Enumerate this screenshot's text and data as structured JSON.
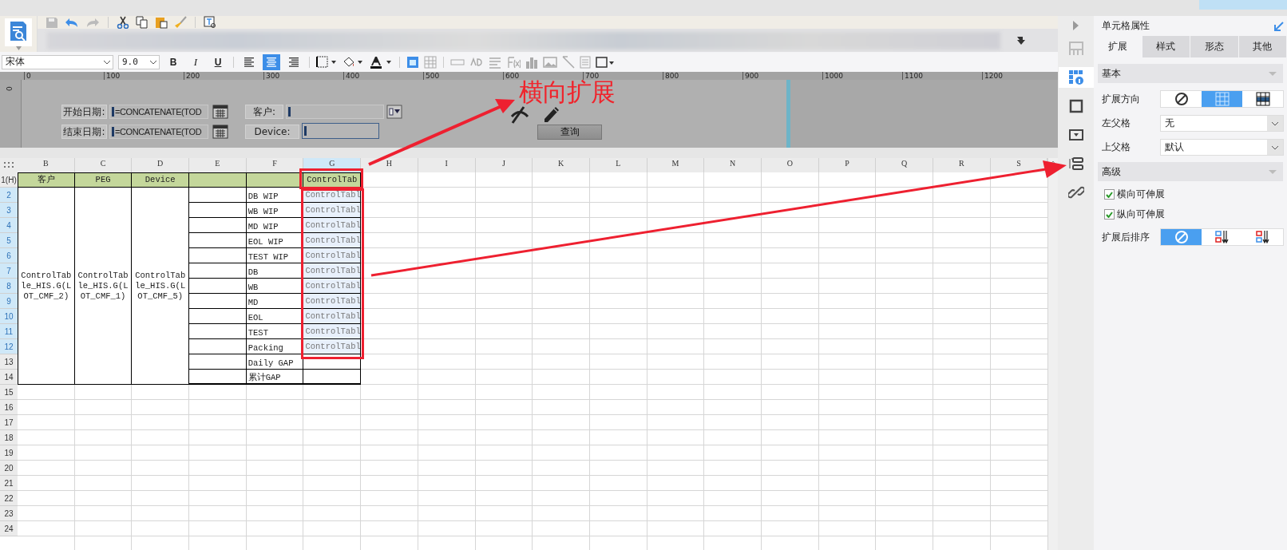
{
  "toolbar": {
    "font": "宋体",
    "font_size": "9.0",
    "bold": "B",
    "italic": "I",
    "underline": "U",
    "align": [
      {
        "selected": false
      },
      {
        "selected": true
      },
      {
        "selected": false
      }
    ]
  },
  "ruler": [
    "0",
    "100",
    "200",
    "300",
    "400",
    "500",
    "600",
    "700",
    "800",
    "900",
    "1000",
    "1100",
    "1200"
  ],
  "vertical_ruler": "0",
  "parameters": {
    "start_label": "开始日期:",
    "start_value": "=CONCATENATE(TOD",
    "end_label": "结束日期:",
    "end_value": "=CONCATENATE(TOD",
    "customer_label": "客户:",
    "device_label": "Device:",
    "query_button": "查询"
  },
  "annotation": "横向扩展",
  "sheet": {
    "columns": [
      {
        "label": "B",
        "selected": false
      },
      {
        "label": "C",
        "selected": false
      },
      {
        "label": "D",
        "selected": false
      },
      {
        "label": "E",
        "selected": false
      },
      {
        "label": "F",
        "selected": false
      },
      {
        "label": "G",
        "selected": true
      },
      {
        "label": "H",
        "selected": false
      },
      {
        "label": "I",
        "selected": false
      },
      {
        "label": "J",
        "selected": false
      },
      {
        "label": "K",
        "selected": false
      },
      {
        "label": "L",
        "selected": false
      },
      {
        "label": "M",
        "selected": false
      },
      {
        "label": "N",
        "selected": false
      },
      {
        "label": "O",
        "selected": false
      },
      {
        "label": "P",
        "selected": false
      },
      {
        "label": "Q",
        "selected": false
      },
      {
        "label": "R",
        "selected": false
      },
      {
        "label": "S",
        "selected": false
      }
    ],
    "row_numbers": [
      {
        "label": "1(H)",
        "selected": false
      },
      {
        "label": "2",
        "selected": true
      },
      {
        "label": "3",
        "selected": true
      },
      {
        "label": "4",
        "selected": true
      },
      {
        "label": "5",
        "selected": true
      },
      {
        "label": "6",
        "selected": true
      },
      {
        "label": "7",
        "selected": true
      },
      {
        "label": "8",
        "selected": true
      },
      {
        "label": "9",
        "selected": true
      },
      {
        "label": "10",
        "selected": true
      },
      {
        "label": "11",
        "selected": true
      },
      {
        "label": "12",
        "selected": true
      },
      {
        "label": "13",
        "selected": false
      },
      {
        "label": "14",
        "selected": false
      },
      {
        "label": "15",
        "selected": false
      },
      {
        "label": "16",
        "selected": false
      },
      {
        "label": "17",
        "selected": false
      },
      {
        "label": "18",
        "selected": false
      },
      {
        "label": "19",
        "selected": false
      },
      {
        "label": "20",
        "selected": false
      },
      {
        "label": "21",
        "selected": false
      },
      {
        "label": "22",
        "selected": false
      },
      {
        "label": "23",
        "selected": false
      },
      {
        "label": "24",
        "selected": false
      }
    ],
    "report_rows": [
      {
        "cells": [
          {
            "kind": "header",
            "text": "客户"
          },
          {
            "kind": "header",
            "text": "PEG"
          },
          {
            "kind": "header",
            "text": "Device"
          },
          {
            "kind": "header"
          },
          {
            "kind": "header"
          },
          {
            "kind": "header",
            "text": "ControlTab"
          }
        ]
      },
      {
        "cells": [
          {
            "kind": "merged",
            "text": "ControlTable_HIS.G(LOT_CMF_2)"
          },
          {
            "kind": "merged",
            "text": "ControlTable_HIS.G(LOT_CMF_1)"
          },
          {
            "kind": "merged",
            "text": "ControlTable_HIS.G(LOT_CMF_5)"
          },
          {
            "kind": "plain"
          },
          {
            "kind": "plain",
            "text": "DB WIP"
          },
          {
            "kind": "expand",
            "text": "ControlTabl"
          }
        ]
      },
      {
        "cells": [
          {
            "kind": "plain"
          },
          {
            "kind": "plain",
            "text": "WB WIP"
          },
          {
            "kind": "expand",
            "text": "ControlTabl"
          }
        ]
      },
      {
        "cells": [
          {
            "kind": "plain"
          },
          {
            "kind": "plain",
            "text": "MD WIP"
          },
          {
            "kind": "expand",
            "text": "ControlTabl"
          }
        ]
      },
      {
        "cells": [
          {
            "kind": "plain"
          },
          {
            "kind": "plain",
            "text": "EOL WIP"
          },
          {
            "kind": "expand",
            "text": "ControlTabl"
          }
        ]
      },
      {
        "cells": [
          {
            "kind": "plain"
          },
          {
            "kind": "plain",
            "text": "TEST WIP"
          },
          {
            "kind": "expand",
            "text": "ControlTabl"
          }
        ]
      },
      {
        "cells": [
          {
            "kind": "plain"
          },
          {
            "kind": "plain",
            "text": "DB"
          },
          {
            "kind": "expand",
            "text": "ControlTabl"
          }
        ]
      },
      {
        "cells": [
          {
            "kind": "plain"
          },
          {
            "kind": "plain",
            "text": "WB"
          },
          {
            "kind": "expand",
            "text": "ControlTabl"
          }
        ]
      },
      {
        "cells": [
          {
            "kind": "plain"
          },
          {
            "kind": "plain",
            "text": "MD"
          },
          {
            "kind": "expand",
            "text": "ControlTabl"
          }
        ]
      },
      {
        "cells": [
          {
            "kind": "plain"
          },
          {
            "kind": "plain",
            "text": "EOL"
          },
          {
            "kind": "expand",
            "text": "ControlTabl"
          }
        ]
      },
      {
        "cells": [
          {
            "kind": "plain"
          },
          {
            "kind": "plain",
            "text": "TEST"
          },
          {
            "kind": "expand",
            "text": "ControlTabl"
          }
        ]
      },
      {
        "cells": [
          {
            "kind": "plain"
          },
          {
            "kind": "plain",
            "text": "Packing"
          },
          {
            "kind": "expand",
            "text": "ControlTabl"
          }
        ]
      },
      {
        "cells": [
          {
            "kind": "plain"
          },
          {
            "kind": "plain",
            "text": "Daily GAP"
          },
          {
            "kind": "plain"
          }
        ]
      },
      {
        "cells": [
          {
            "kind": "plain"
          },
          {
            "kind": "plain",
            "text": "累计GAP"
          },
          {
            "kind": "plain"
          }
        ]
      }
    ]
  },
  "side_icons": [
    {
      "selected": false
    },
    {
      "selected": true
    },
    {
      "selected": false
    },
    {
      "selected": false
    },
    {
      "selected": false
    },
    {
      "selected": false
    }
  ],
  "properties": {
    "title": "单元格属性",
    "tabs": [
      {
        "label": "扩展",
        "selected": true
      },
      {
        "label": "样式",
        "selected": false
      },
      {
        "label": "形态",
        "selected": false
      },
      {
        "label": "其他",
        "selected": false
      }
    ],
    "basic": {
      "title": "基本",
      "direction_label": "扩展方向",
      "direction_options": [
        {
          "selected": false
        },
        {
          "selected": true
        },
        {
          "selected": false
        }
      ],
      "left_parent_label": "左父格",
      "left_parent_value": "无",
      "top_parent_label": "上父格",
      "top_parent_value": "默认"
    },
    "advanced": {
      "title": "高级",
      "options": [
        {
          "label": "横向可伸展",
          "checked": true
        },
        {
          "label": "纵向可伸展",
          "checked": true
        }
      ],
      "sort_label": "扩展后排序",
      "sort_options": [
        {
          "selected": true
        },
        {
          "selected": false
        },
        {
          "selected": false
        }
      ]
    }
  }
}
